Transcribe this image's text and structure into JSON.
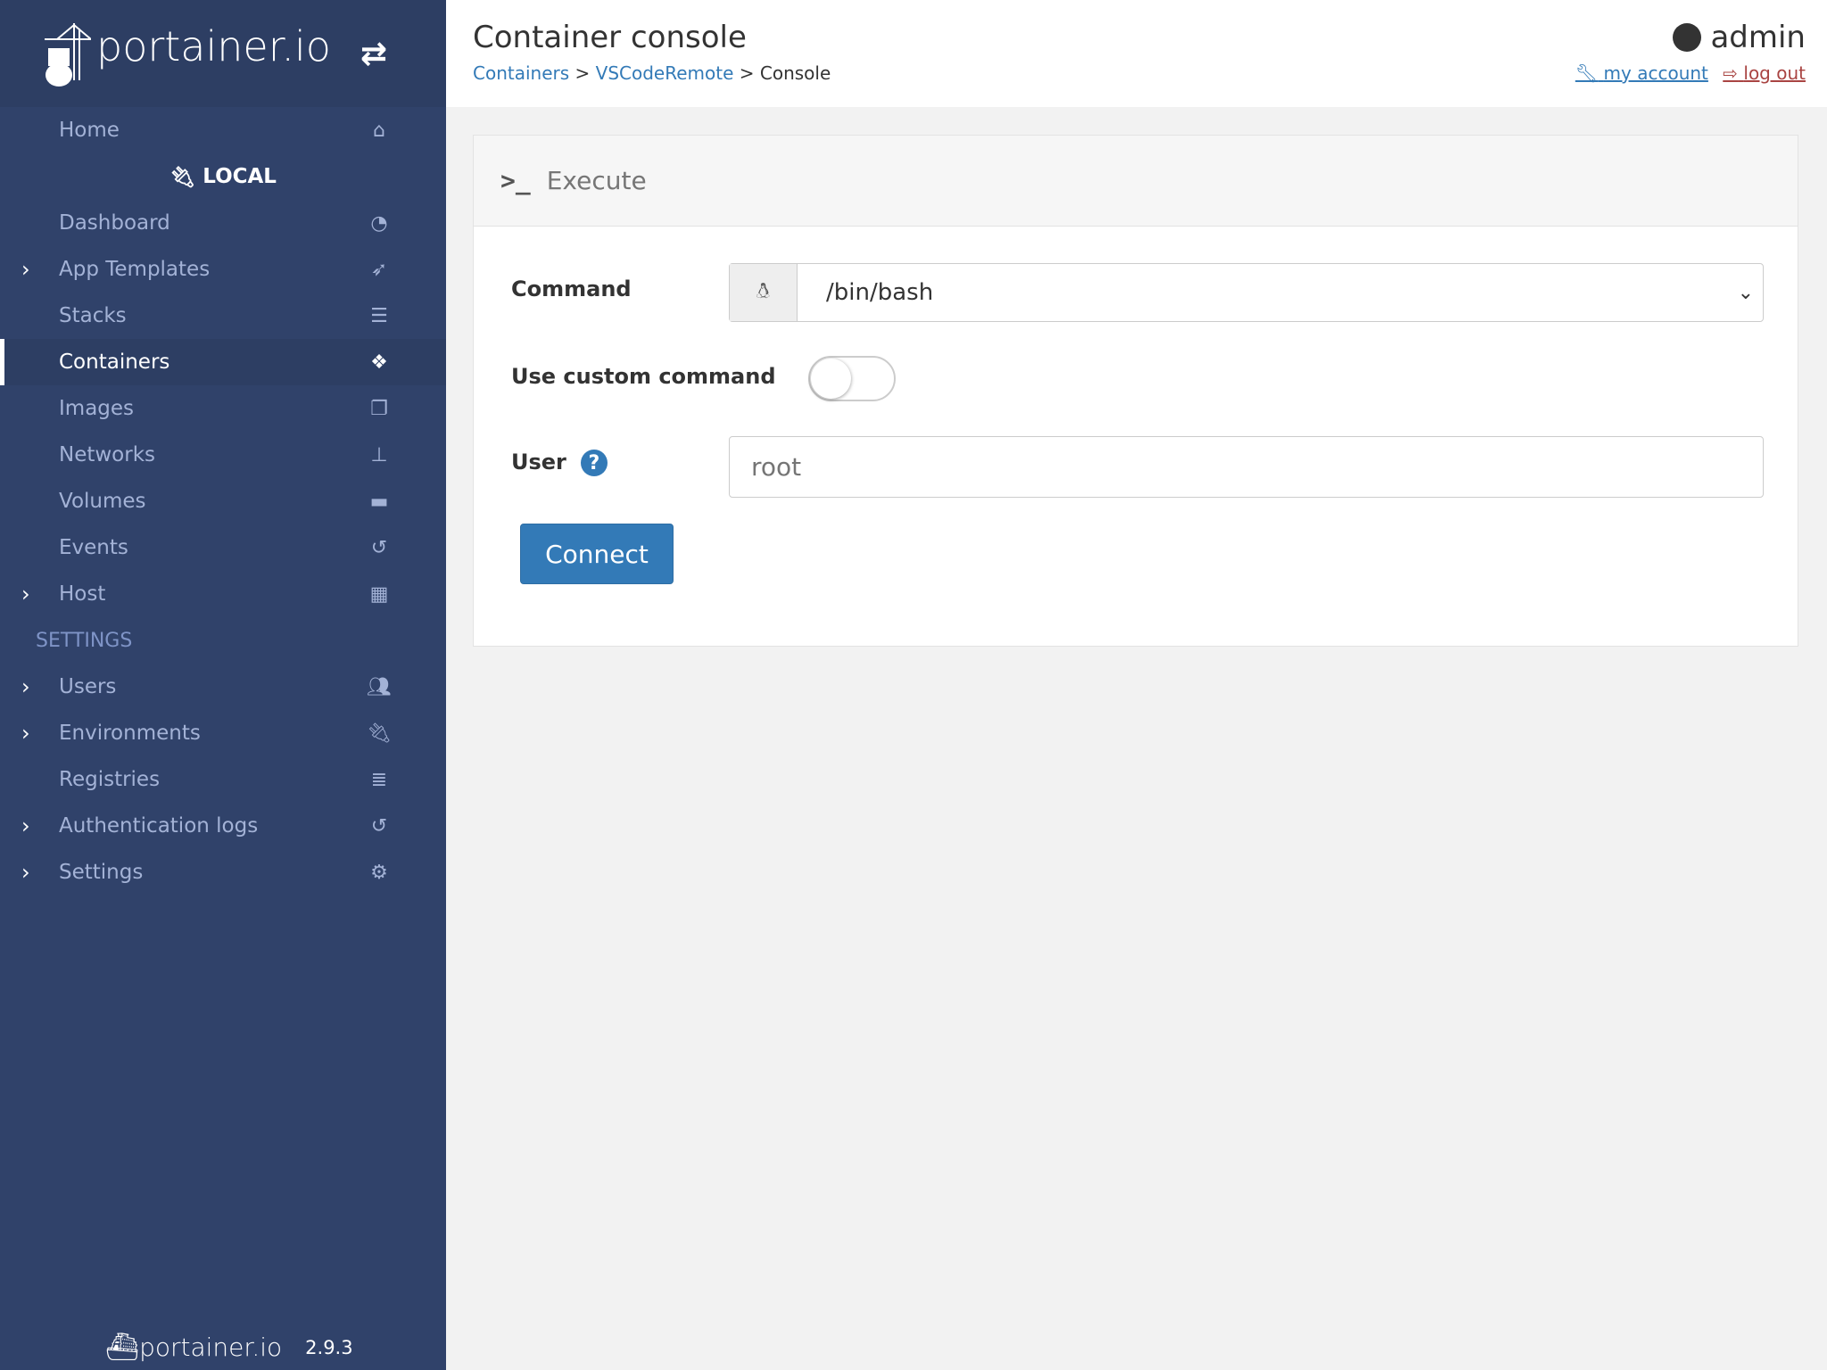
{
  "sidebar": {
    "brand": "portainer.io",
    "home": "Home",
    "endpoint": "LOCAL",
    "items": [
      {
        "label": "Dashboard",
        "icon": "tachometer-icon"
      },
      {
        "label": "App Templates",
        "icon": "rocket-icon",
        "expandable": true
      },
      {
        "label": "Stacks",
        "icon": "list-icon"
      },
      {
        "label": "Containers",
        "icon": "cubes-icon",
        "active": true
      },
      {
        "label": "Images",
        "icon": "clone-icon"
      },
      {
        "label": "Networks",
        "icon": "sitemap-icon"
      },
      {
        "label": "Volumes",
        "icon": "hdd-icon"
      },
      {
        "label": "Events",
        "icon": "history-icon"
      },
      {
        "label": "Host",
        "icon": "th-icon",
        "expandable": true
      }
    ],
    "settings_header": "SETTINGS",
    "settings_items": [
      {
        "label": "Users",
        "icon": "users-icon",
        "expandable": true
      },
      {
        "label": "Environments",
        "icon": "plug-icon",
        "expandable": true
      },
      {
        "label": "Registries",
        "icon": "database-icon"
      },
      {
        "label": "Authentication logs",
        "icon": "history-icon",
        "expandable": true
      },
      {
        "label": "Settings",
        "icon": "cogs-icon",
        "expandable": true
      }
    ],
    "footer": {
      "brand": "portainer.io",
      "version": "2.9.3"
    }
  },
  "header": {
    "title": "Container console",
    "breadcrumb": [
      "Containers",
      "VSCodeRemote",
      "Console"
    ],
    "user": "admin",
    "my_account": "my account",
    "log_out": "log out"
  },
  "panel": {
    "title": "Execute",
    "command_label": "Command",
    "command_value": "/bin/bash",
    "custom_label": "Use custom command",
    "custom_enabled": false,
    "user_label": "User",
    "user_placeholder": "root",
    "connect": "Connect"
  },
  "colors": {
    "sidebar": "#30426a",
    "primary": "#337ab7",
    "danger": "#a94442"
  }
}
